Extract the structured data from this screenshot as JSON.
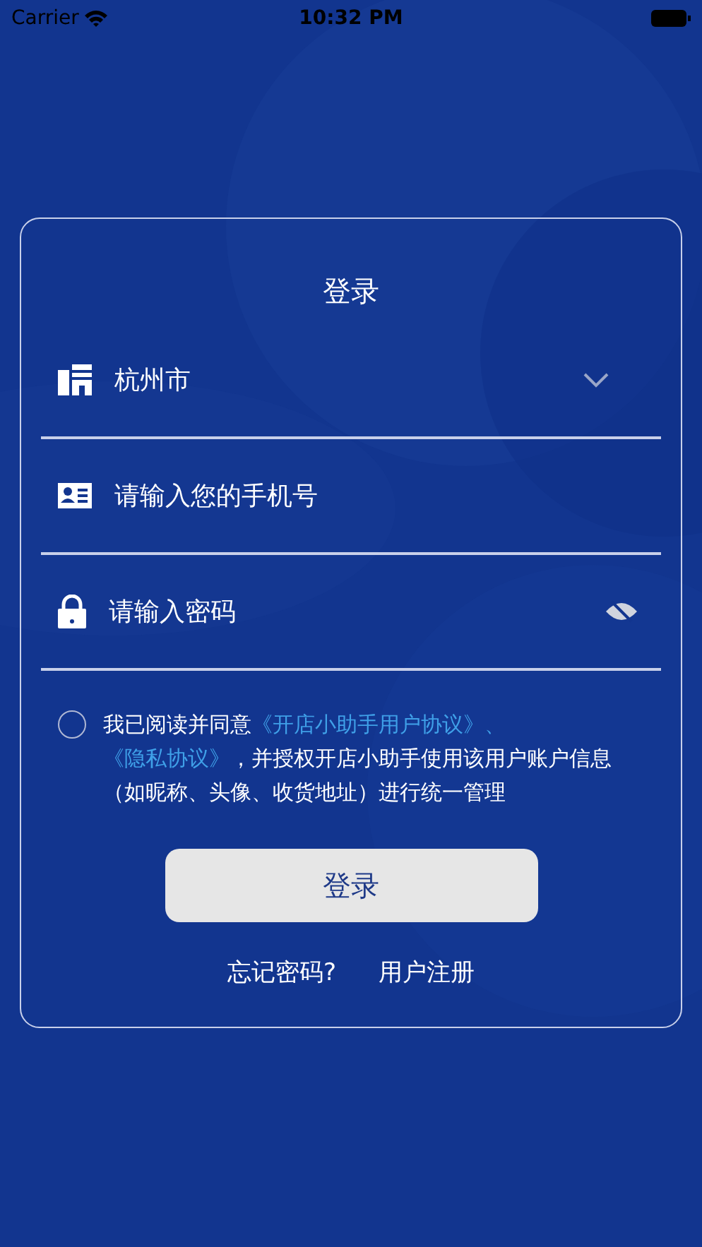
{
  "status_bar": {
    "carrier": "Carrier",
    "time": "10:32 PM"
  },
  "login_card": {
    "title": "登录",
    "fields": [
      {
        "kind": "city",
        "value": "杭州市"
      },
      {
        "kind": "phone",
        "placeholder": "请输入您的手机号"
      },
      {
        "kind": "password",
        "placeholder": "请输入密码"
      }
    ],
    "agreement": {
      "checked": false,
      "segments": [
        {
          "kind": "text",
          "text": "我已阅读并同意"
        },
        {
          "kind": "link",
          "text": "《开店小助手用户协议》"
        },
        {
          "kind": "link",
          "text": "、"
        },
        {
          "kind": "link",
          "text": "《隐私协议》"
        },
        {
          "kind": "text",
          "text": "，并授权开店小助手使用该用户账户信息（如昵称、头像、收货地址）进行统一管理"
        }
      ]
    },
    "login_button": "登录",
    "links": [
      "忘记密码?",
      "用户注册"
    ]
  }
}
